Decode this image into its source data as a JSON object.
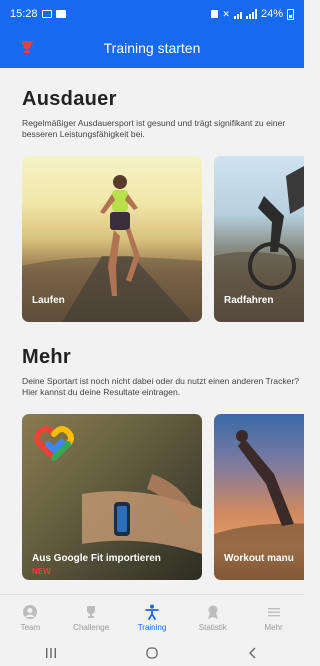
{
  "status_bar": {
    "time": "15:28",
    "battery": "24%"
  },
  "header": {
    "title": "Training starten",
    "accent": "#1769f0",
    "trophy_color": "#e8403a"
  },
  "sections": {
    "ausdauer": {
      "title": "Ausdauer",
      "description": "Regelmäßiger Ausdauersport ist gesund und trägt signifikant zu einer besseren Leistungsfähigkeit bei.",
      "cards": [
        {
          "label": "Laufen"
        },
        {
          "label": "Radfahren"
        }
      ]
    },
    "mehr": {
      "title": "Mehr",
      "description": "Deine Sportart ist noch nicht dabei oder du nutzt einen anderen Tracker? Hier kannst du deine Resultate eintragen.",
      "cards": [
        {
          "label": "Aus Google Fit importieren",
          "badge": "NEW"
        },
        {
          "label": "Workout manu"
        }
      ]
    }
  },
  "bottom_nav": {
    "items": [
      {
        "label": "Team",
        "icon": "team-icon"
      },
      {
        "label": "Challenge",
        "icon": "trophy-icon"
      },
      {
        "label": "Training",
        "icon": "figure-icon",
        "active": true
      },
      {
        "label": "Statistik",
        "icon": "award-icon"
      },
      {
        "label": "Mehr",
        "icon": "menu-icon"
      }
    ],
    "active_color": "#1769f0"
  }
}
